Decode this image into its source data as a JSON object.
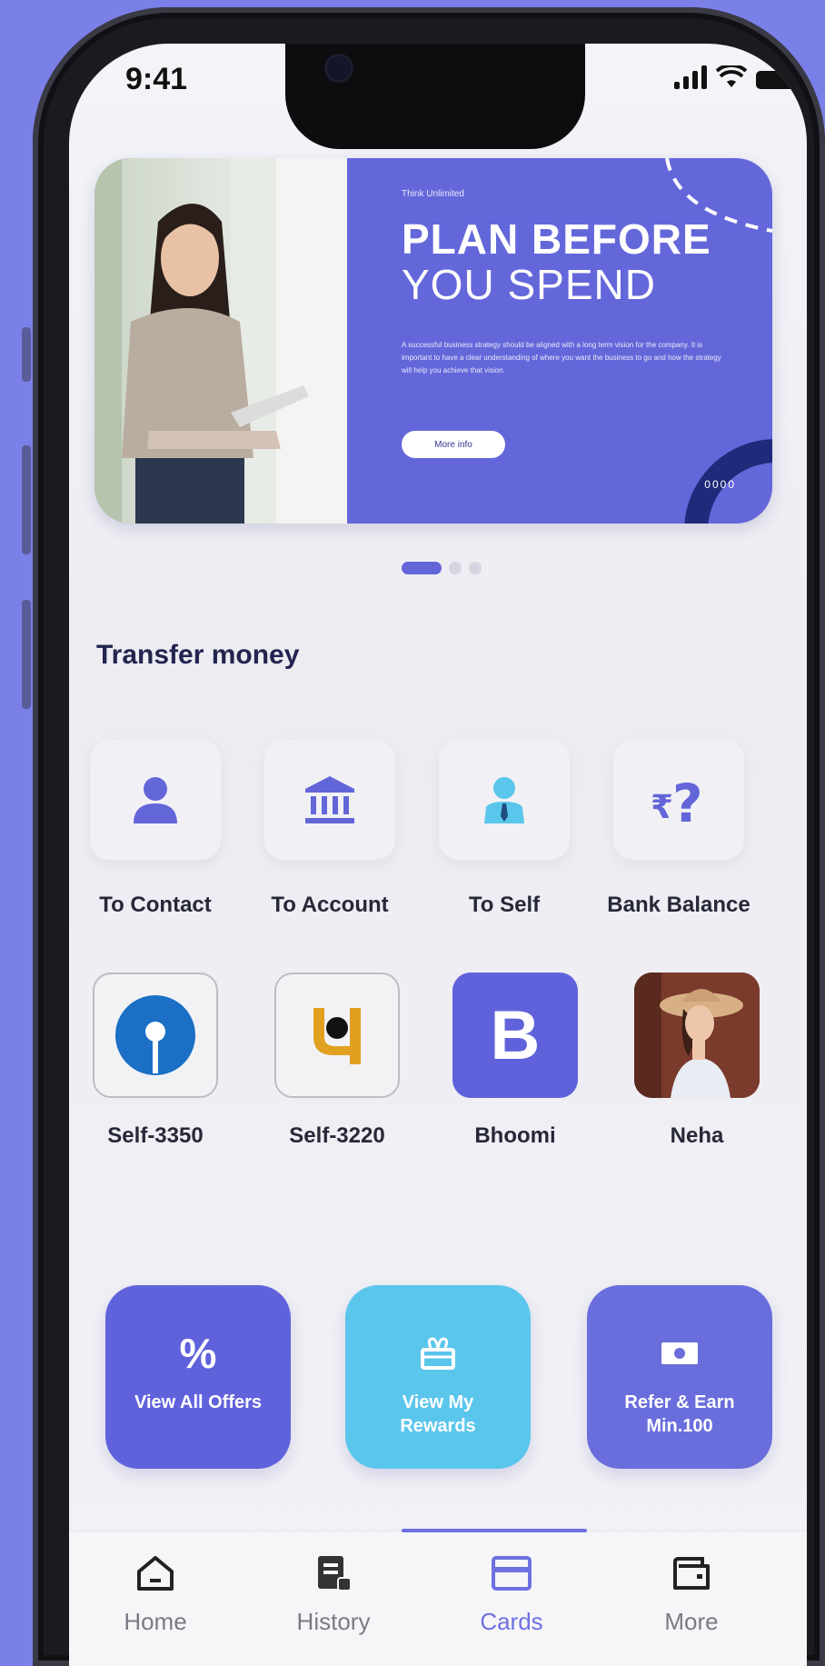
{
  "status_bar": {
    "time": "9:41"
  },
  "banner": {
    "kicker": "Think Unlimited",
    "headline_bold": "PLAN BEFORE",
    "headline_light": "YOU SPEND",
    "body": "A successful business strategy should be aligned with a long term vision for the company. It is important to have a clear understanding of where you want the business to go and how the strategy will help you achieve that vision.",
    "button_label": "More info",
    "dots": "0000"
  },
  "carousel": {
    "active_index": 0,
    "count": 3
  },
  "transfer": {
    "title": "Transfer money",
    "items": [
      {
        "label": "To Contact",
        "icon": "person-icon"
      },
      {
        "label": "To Account",
        "icon": "bank-icon"
      },
      {
        "label": "To Self",
        "icon": "self-user-icon"
      },
      {
        "label": "Bank Balance",
        "icon": "rupee-question-icon"
      }
    ]
  },
  "payees": [
    {
      "label": "Self-3350",
      "icon": "sbi-logo"
    },
    {
      "label": "Self-3220",
      "icon": "pnb-logo"
    },
    {
      "label": "Bhoomi",
      "initial": "B"
    },
    {
      "label": "Neha",
      "icon": "avatar-photo"
    }
  ],
  "actions": [
    {
      "label": "View All Offers",
      "icon": "percent-icon",
      "color": "#6062dc"
    },
    {
      "label": "View My Rewards",
      "icon": "gift-icon",
      "color": "#5bc6ec"
    },
    {
      "label": "Refer & Earn Min.100",
      "icon": "cash-icon",
      "color": "#6a6ddc"
    }
  ],
  "tabbar": {
    "active": "Cards",
    "tabs": [
      {
        "label": "Home",
        "icon": "home-icon"
      },
      {
        "label": "History",
        "icon": "history-icon"
      },
      {
        "label": "Cards",
        "icon": "card-icon"
      },
      {
        "label": "More",
        "icon": "wallet-icon"
      }
    ]
  },
  "colors": {
    "accent": "#6366d8",
    "background": "#7b80e8",
    "sky": "#5bc6ec",
    "title": "#23244f"
  }
}
